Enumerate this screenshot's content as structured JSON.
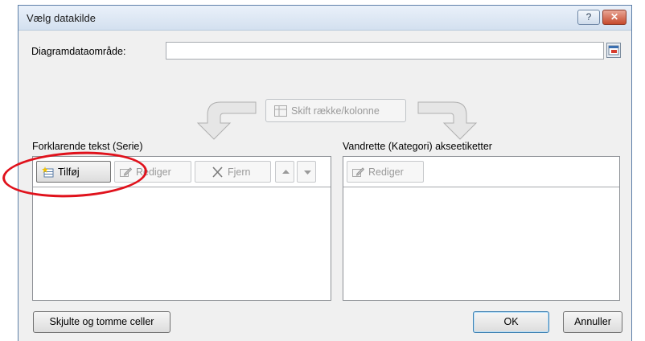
{
  "dialog": {
    "title": "Vælg datakilde",
    "help_label": "?",
    "close_label": "✕"
  },
  "range": {
    "label": "Diagramdataområde:",
    "value": ""
  },
  "switch_button": {
    "label": "Skift række/kolonne"
  },
  "series_panel": {
    "title": "Forklarende tekst (Serie)",
    "add_label": "Tilføj",
    "edit_label": "Rediger",
    "remove_label": "Fjern",
    "items": []
  },
  "category_panel": {
    "title": "Vandrette (Kategori) akseetiketter",
    "edit_label": "Rediger",
    "items": []
  },
  "footer": {
    "hidden_cells_label": "Skjulte og tomme celler",
    "ok_label": "OK",
    "cancel_label": "Annuller"
  },
  "colors": {
    "highlight": "#e0121c",
    "title_bar": "#d3e0ef",
    "close_button": "#c64a2d"
  },
  "icons": [
    "help-icon",
    "close-icon",
    "collapse-dialog-icon",
    "curved-arrow-left-icon",
    "curved-arrow-right-icon",
    "switch-table-icon",
    "add-series-icon",
    "edit-icon",
    "remove-x-icon",
    "move-up-icon",
    "move-down-icon"
  ]
}
